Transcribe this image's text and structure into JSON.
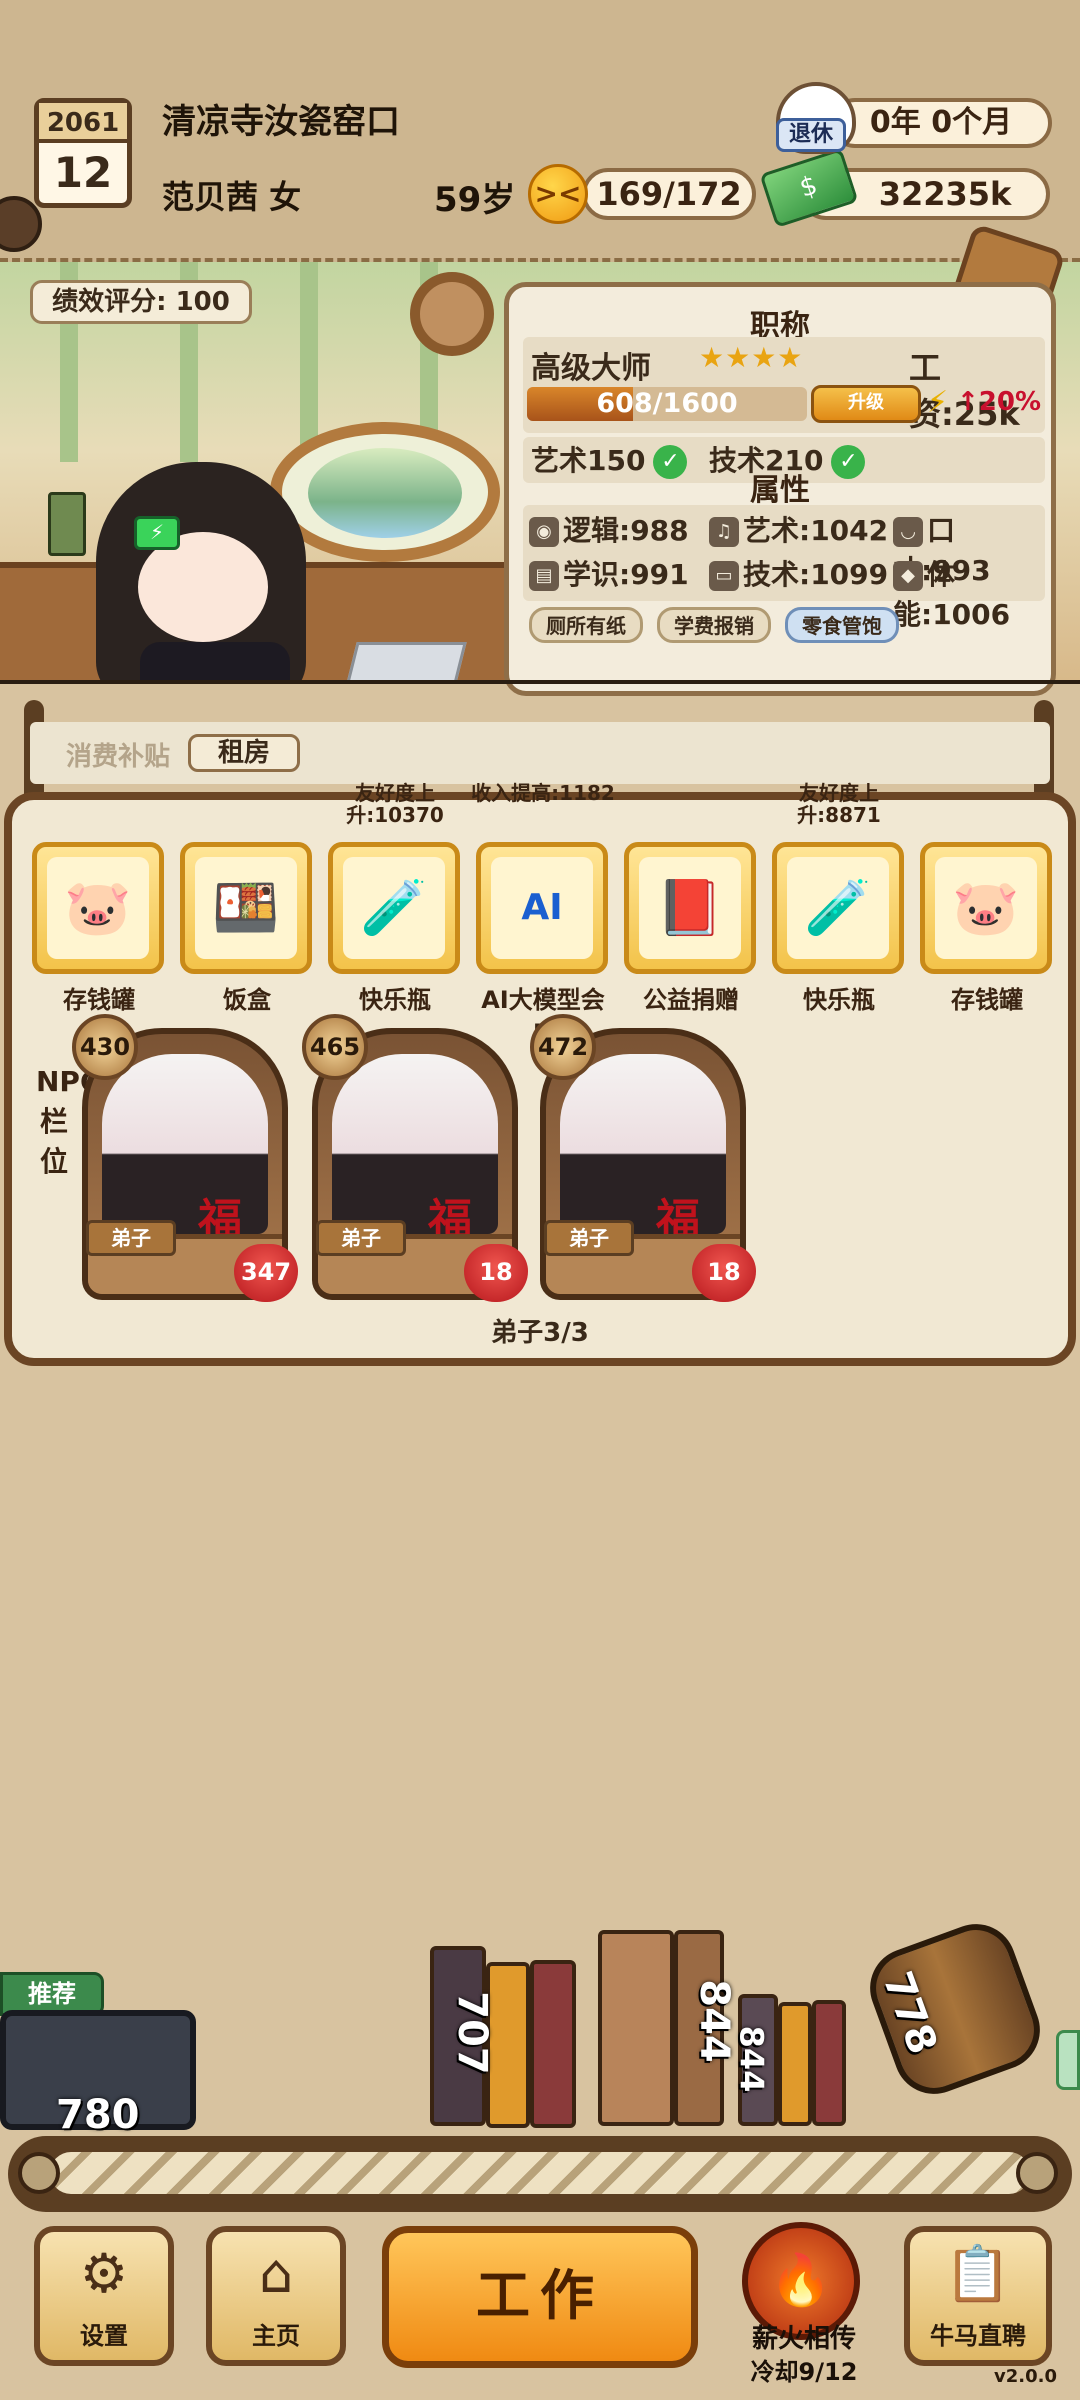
{
  "header": {
    "year": "2061",
    "month": "12",
    "company": "清凉寺汝瓷窑口",
    "player": "范贝茜 女",
    "age": "59岁",
    "mood_face": "><",
    "mood": "169/172",
    "retire_tag": "退休",
    "retire_time": "0年 0个月",
    "money": "32235k"
  },
  "scene": {
    "score": "绩效评分: 100"
  },
  "info": {
    "title_section": "职称",
    "rank": "高级大师",
    "stars": "★★★★",
    "salary": "工资:25k",
    "xp_text": "608/1600",
    "xp_fraction": 0.38,
    "upgrade_label": "升级",
    "bonus": "↑20%",
    "skill_art": "艺术150",
    "skill_tech": "技术210",
    "attr_section": "属性",
    "attrs": {
      "logic": "逻辑:988",
      "art": "艺术:1042",
      "speech": "口才:993",
      "knowledge": "学识:991",
      "tech": "技术:1099",
      "stamina": "体能:1006"
    },
    "perks": [
      "厕所有纸",
      "学费报销",
      "零食管饱"
    ],
    "perk_colors": [
      "#e8dcc2",
      "#e8dcc2",
      "#cfe0f2"
    ]
  },
  "subsidy": {
    "label": "消费补贴",
    "tag": "租房"
  },
  "items": [
    {
      "label": "存钱罐",
      "top": "",
      "icon": "piggy-bank-icon",
      "glyph": "🐷"
    },
    {
      "label": "饭盒",
      "top": "",
      "icon": "lunchbox-icon",
      "glyph": "🍱"
    },
    {
      "label": "快乐瓶",
      "top": "友好度上升:10370",
      "icon": "potion-icon",
      "glyph": "🧪"
    },
    {
      "label": "AI大模型会员",
      "top": "收入提高:1182",
      "icon": "ai-card-icon",
      "glyph": "AI"
    },
    {
      "label": "公益捐赠",
      "top": "",
      "icon": "donation-icon",
      "glyph": "📕"
    },
    {
      "label": "快乐瓶",
      "top": "友好度上升:8871",
      "icon": "potion-icon",
      "glyph": "🧪"
    },
    {
      "label": "存钱罐",
      "top": "",
      "icon": "piggy-bank-icon",
      "glyph": "🐷"
    }
  ],
  "npc": {
    "side_label": "NPC栏位",
    "cards": [
      {
        "level": "430",
        "role": "弟子",
        "seal": "福",
        "hearts": "347"
      },
      {
        "level": "465",
        "role": "弟子",
        "seal": "福",
        "hearts": "18"
      },
      {
        "level": "472",
        "role": "弟子",
        "seal": "福",
        "hearts": "18"
      }
    ],
    "count": "弟子3/3"
  },
  "conveyor": {
    "recommend": "推荐",
    "chest_value": "780",
    "book1_value": "707",
    "book2_value": "844",
    "book3_value": "844",
    "barrel_value": "778"
  },
  "nav": {
    "settings": "设置",
    "home": "主页",
    "work": "工作",
    "fire": "薪火相传",
    "cooldown": "冷却9/12",
    "hire": "牛马直聘",
    "version": "v2.0.0"
  }
}
